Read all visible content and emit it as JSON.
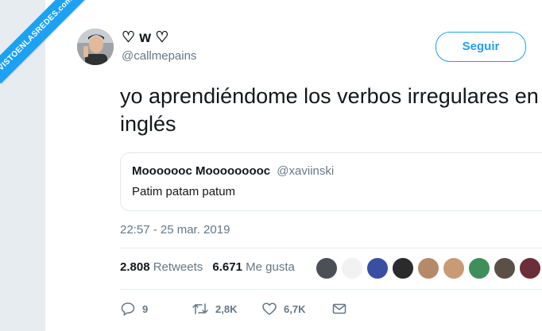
{
  "watermark": "VISTOENLASREDES.com",
  "user": {
    "display_name": "♡ w ♡",
    "handle": "@callmepains"
  },
  "follow_label": "Seguir",
  "tweet_text": "yo aprendiéndome los verbos irregulares en inglés",
  "quoted": {
    "name": "Mooooooc Mooooooooc",
    "handle": "@xaviinski",
    "text": "Patim patam patum"
  },
  "timestamp": "22:57 - 25 mar. 2019",
  "stats": {
    "retweets_count": "2.808",
    "retweets_label": "Retweets",
    "likes_count": "6.671",
    "likes_label": "Me gusta"
  },
  "actions": {
    "replies": "9",
    "retweets": "2,8K",
    "likes": "6,7K"
  },
  "colors": {
    "accent": "#1da1f2",
    "secondary_text": "#657786"
  }
}
